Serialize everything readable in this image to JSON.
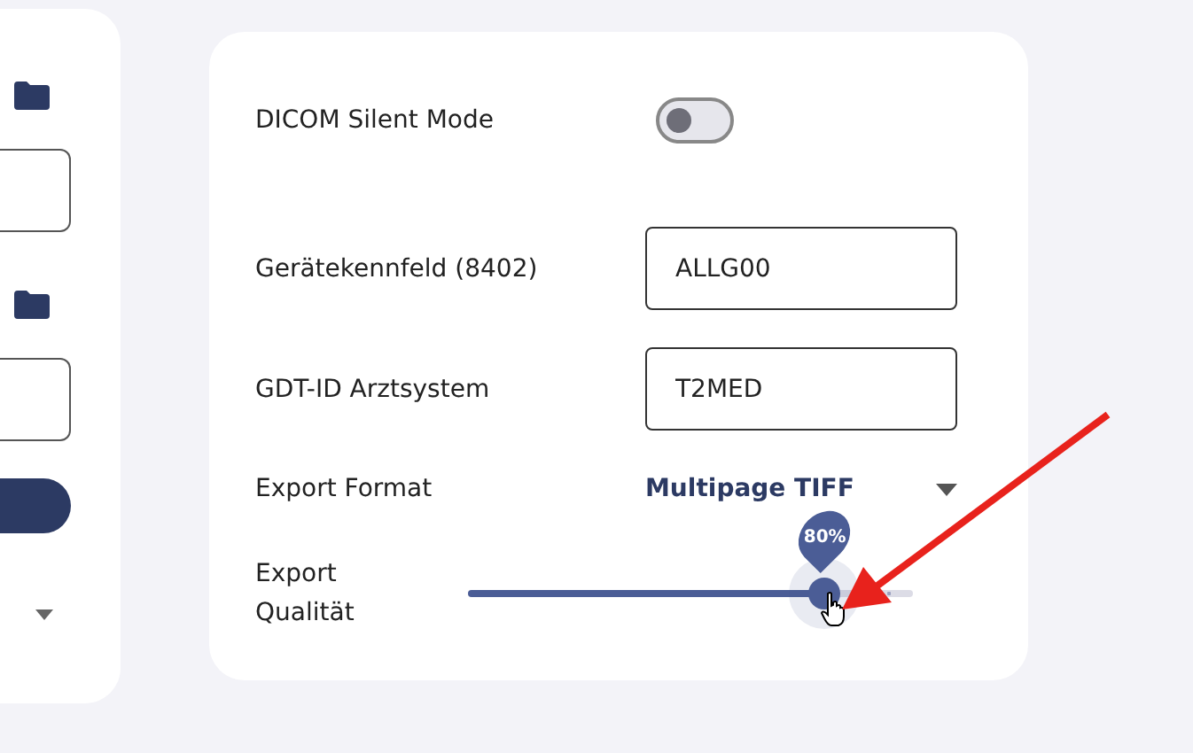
{
  "side_panel": {
    "items": [
      {
        "kind": "folder"
      },
      {
        "kind": "field"
      },
      {
        "kind": "folder"
      },
      {
        "kind": "field"
      },
      {
        "kind": "button"
      },
      {
        "kind": "dropdown"
      }
    ]
  },
  "settings": {
    "rows": [
      {
        "kind": "toggle",
        "label": "DICOM Silent Mode",
        "on": false
      },
      {
        "kind": "input",
        "label": "Gerätekennfeld (8402)",
        "value": "ALLG00"
      },
      {
        "kind": "input",
        "label": "GDT-ID Arztsystem",
        "value": "T2MED"
      },
      {
        "kind": "select",
        "label": "Export Format",
        "value": "Multipage TIFF"
      },
      {
        "kind": "slider",
        "label": "Export Qualität",
        "level": 0.8,
        "tooltip": "80%"
      }
    ]
  }
}
